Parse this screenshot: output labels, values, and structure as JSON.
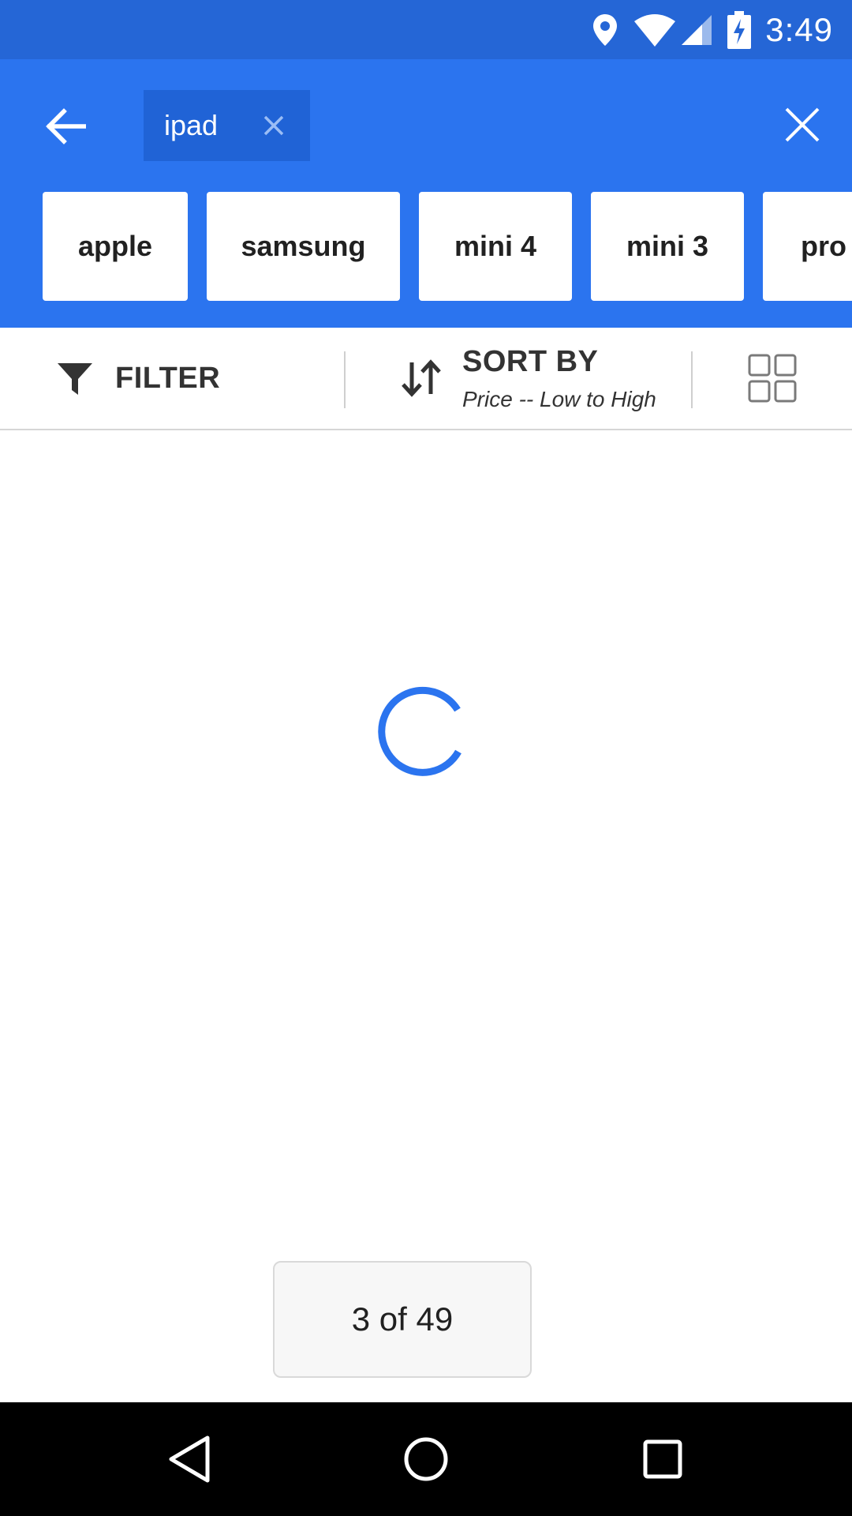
{
  "status_bar": {
    "time": "3:49",
    "icons": [
      "location-icon",
      "wifi-icon",
      "cell-signal-icon",
      "battery-charging-icon"
    ],
    "background": "#2566d6"
  },
  "search_header": {
    "query_chip": "ipad",
    "back_icon": "arrow-left-icon",
    "close_icon": "close-icon",
    "background": "#2b74ef"
  },
  "suggestions": [
    "apple",
    "samsung",
    "mini 4",
    "mini 3",
    "pro"
  ],
  "toolbar": {
    "filter_label": "FILTER",
    "sort_label": "SORT BY",
    "sort_value": "Price -- Low to High",
    "view_icon": "grid-view-icon"
  },
  "content": {
    "loading": true,
    "accent": "#2b74ef"
  },
  "page_indicator": {
    "text": "3 of 49"
  },
  "nav_bar": {
    "icons": [
      "nav-back-icon",
      "nav-home-icon",
      "nav-recents-icon"
    ]
  }
}
